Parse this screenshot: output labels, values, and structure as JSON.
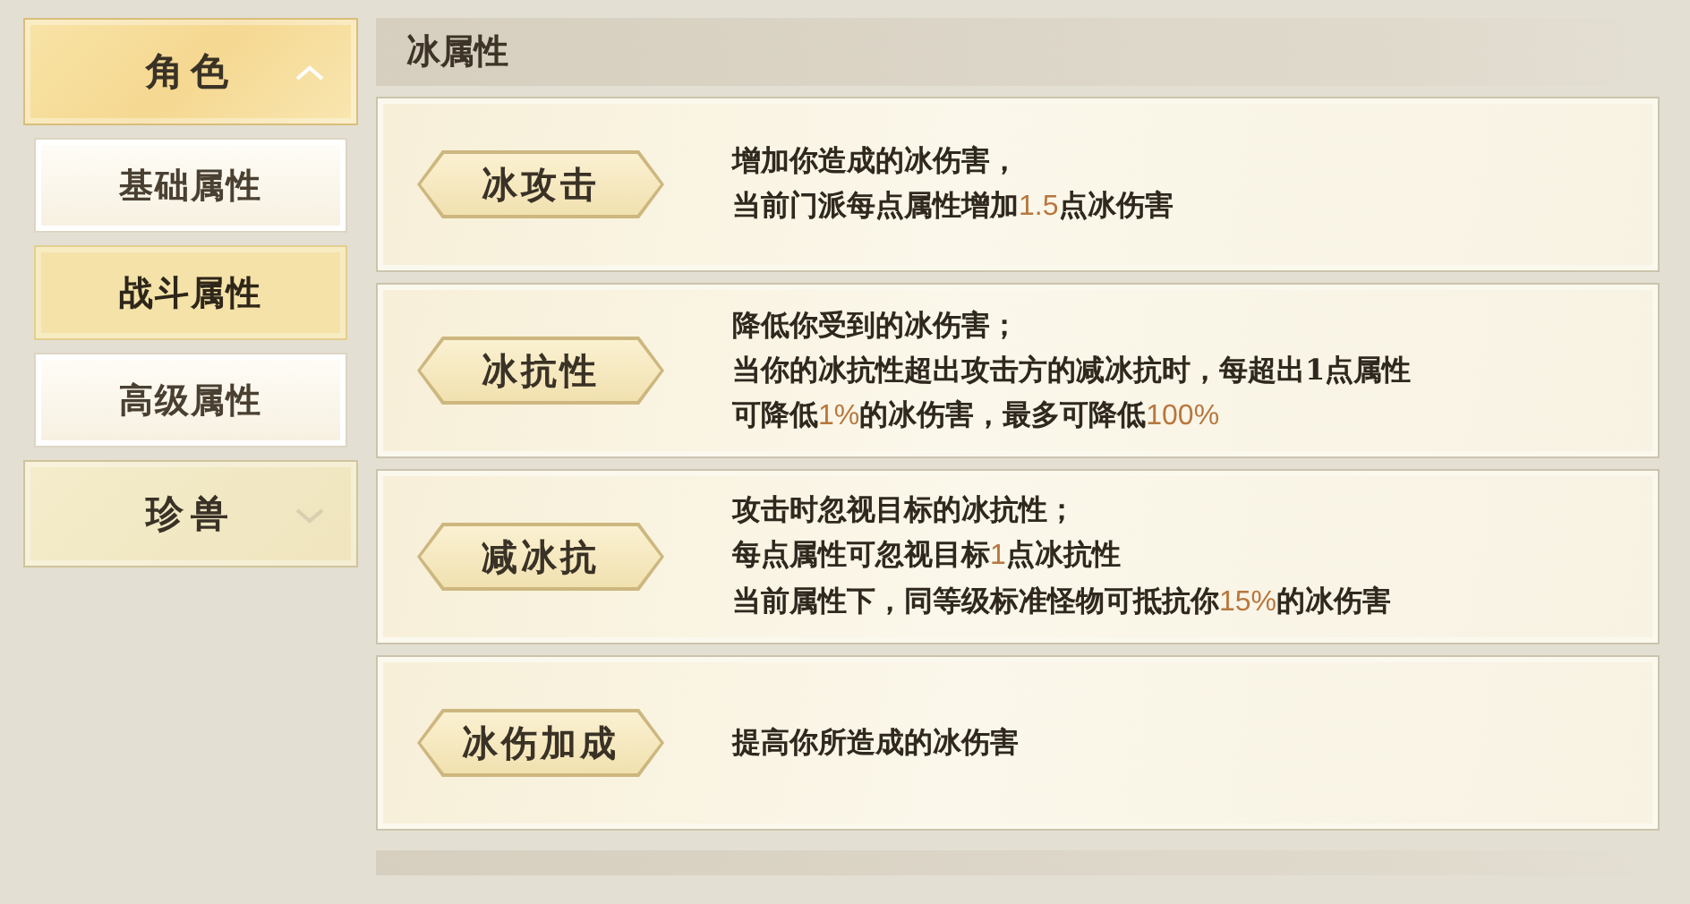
{
  "sidebar": {
    "groups": [
      {
        "label": "角色",
        "expanded": true,
        "items": [
          {
            "label": "基础属性",
            "selected": false
          },
          {
            "label": "战斗属性",
            "selected": true
          },
          {
            "label": "高级属性",
            "selected": false
          }
        ]
      },
      {
        "label": "珍兽",
        "expanded": false
      }
    ]
  },
  "section": {
    "title": "冰属性",
    "attributes": [
      {
        "name": "冰攻击",
        "lines": [
          [
            {
              "text": "增加你造成的冰伤害，",
              "highlight": false
            }
          ],
          [
            {
              "text": "当前门派每点属性增加",
              "highlight": false
            },
            {
              "text": "1.5",
              "highlight": true
            },
            {
              "text": "点冰伤害",
              "highlight": false
            }
          ]
        ]
      },
      {
        "name": "冰抗性",
        "lines": [
          [
            {
              "text": "降低你受到的冰伤害；",
              "highlight": false
            }
          ],
          [
            {
              "text": "当你的冰抗性超出攻击方的减冰抗时，每超出1点属性",
              "highlight": false
            }
          ],
          [
            {
              "text": "可降低",
              "highlight": false
            },
            {
              "text": "1%",
              "highlight": true
            },
            {
              "text": "的冰伤害，最多可降低",
              "highlight": false
            },
            {
              "text": "100%",
              "highlight": true
            }
          ]
        ]
      },
      {
        "name": "减冰抗",
        "lines": [
          [
            {
              "text": "攻击时忽视目标的冰抗性；",
              "highlight": false
            }
          ],
          [
            {
              "text": "每点属性可忽视目标",
              "highlight": false
            },
            {
              "text": "1",
              "highlight": true
            },
            {
              "text": "点冰抗性",
              "highlight": false
            }
          ],
          [
            {
              "text": "当前属性下，同等级标准怪物可抵抗你",
              "highlight": false
            },
            {
              "text": "15%",
              "highlight": true
            },
            {
              "text": "的冰伤害",
              "highlight": false
            }
          ]
        ]
      },
      {
        "name": "冰伤加成",
        "lines": [
          [
            {
              "text": "提高你所造成的冰伤害",
              "highlight": false
            }
          ]
        ]
      }
    ]
  }
}
